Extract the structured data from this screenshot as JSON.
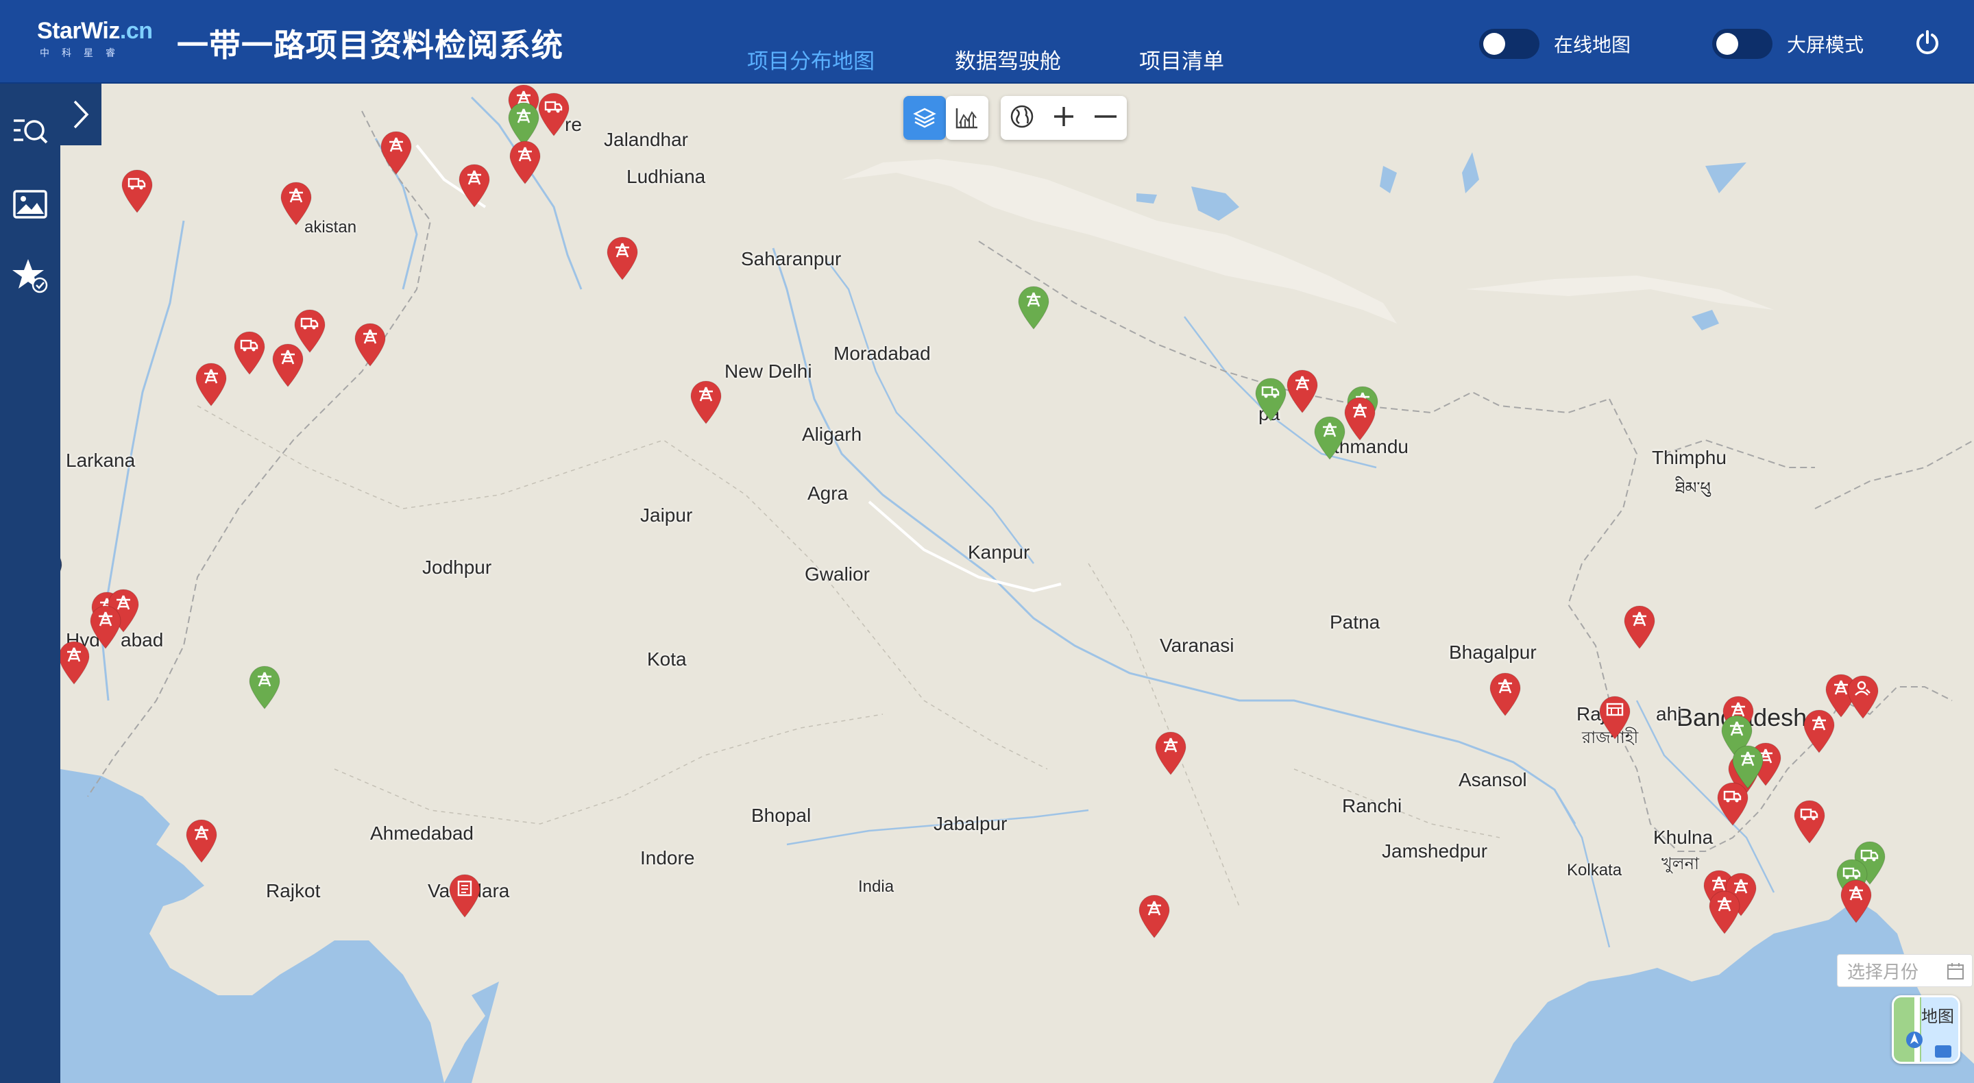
{
  "header": {
    "logo_main": "StarWiz",
    "logo_suffix": ".cn",
    "logo_sub": "中科星睿",
    "title": "一带一路项目资料检阅系统",
    "nav": [
      {
        "label": "项目分布地图",
        "active": true
      },
      {
        "label": "数据驾驶舱",
        "active": false
      },
      {
        "label": "项目清单",
        "active": false
      }
    ],
    "toggles": [
      {
        "label": "在线地图",
        "on": false
      },
      {
        "label": "大屏模式",
        "on": false
      }
    ]
  },
  "sidebar": {
    "items": [
      "search-list-icon",
      "image-icon",
      "star-check-icon"
    ]
  },
  "map": {
    "cities": [
      "Jalandhar",
      "Ludhiana",
      "Saharanpur",
      "New Delhi",
      "Moradabad",
      "Aligarh",
      "Agra",
      "Jaipur",
      "Jodhpur",
      "Gwalior",
      "Kanpur",
      "Kota",
      "Varanasi",
      "Patna",
      "Bhagalpur",
      "Thimphu",
      "Larkana",
      "Ahmedabad",
      "Rajkot",
      "Vadodara",
      "Indore",
      "Bhopal",
      "Jabalpur",
      "Ranchi",
      "Asansol",
      "Jamshedpur",
      "Khulna",
      "Kolkata",
      "Hyderabad",
      "Kathmandu",
      "Rajshahi",
      "Lahore",
      "Pakistan",
      "India"
    ],
    "thimphu_native": "ཐིམ་ཕུ",
    "rajshahi_native": "রাজশাহী",
    "khulna_native": "খুলনা",
    "country_label": "Bangladesh",
    "partial_labels": [
      "Hyd",
      "abad",
      "akistan",
      "Lah",
      "re",
      "pa",
      "thmandu",
      "Raj",
      "ahi"
    ]
  },
  "markers": {
    "colors": {
      "red": "#d93a3a",
      "green": "#6aad4e",
      "navy": "#2b3f66"
    }
  },
  "controls": {
    "month_placeholder": "选择月份",
    "map_switch_label": "地图"
  }
}
